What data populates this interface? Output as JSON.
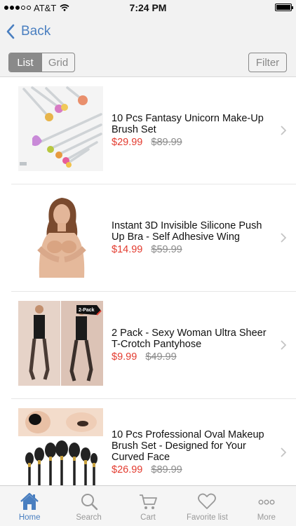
{
  "status_bar": {
    "carrier": "AT&T",
    "time": "7:24 PM",
    "signal_icon": "signal-dots-icon",
    "wifi_icon": "wifi-icon",
    "battery_icon": "battery-icon"
  },
  "nav": {
    "back_label": "Back",
    "back_icon": "chevron-left-icon"
  },
  "toolbar": {
    "view_modes": [
      "List",
      "Grid"
    ],
    "selected_view": "List",
    "filter_label": "Filter"
  },
  "products": [
    {
      "title": "10 Pcs Fantasy Unicorn Make-Up Brush Set",
      "price": "$29.99",
      "old_price": "$89.99"
    },
    {
      "title": "Instant 3D Invisible Silicone Push Up Bra - Self Adhesive Wing",
      "price": "$14.99",
      "old_price": "$59.99"
    },
    {
      "title": "2 Pack - Sexy Woman Ultra Sheer T-Crotch Pantyhose",
      "price": "$9.99",
      "old_price": "$49.99",
      "badge": "2-Pack"
    },
    {
      "title": "10 Pcs Professional Oval Makeup Brush Set - Designed for Your Curved Face",
      "price": "$26.99",
      "old_price": "$89.99"
    }
  ],
  "tabs": [
    {
      "label": "Home",
      "icon": "home-icon",
      "active": true
    },
    {
      "label": "Search",
      "icon": "search-icon",
      "active": false
    },
    {
      "label": "Cart",
      "icon": "cart-icon",
      "active": false
    },
    {
      "label": "Favorite list",
      "icon": "heart-icon",
      "active": false
    },
    {
      "label": "More",
      "icon": "more-dots-icon",
      "active": false
    }
  ],
  "colors": {
    "accent": "#4a7fc0",
    "price": "#e33b2f",
    "old_price": "#8a8a8a"
  }
}
